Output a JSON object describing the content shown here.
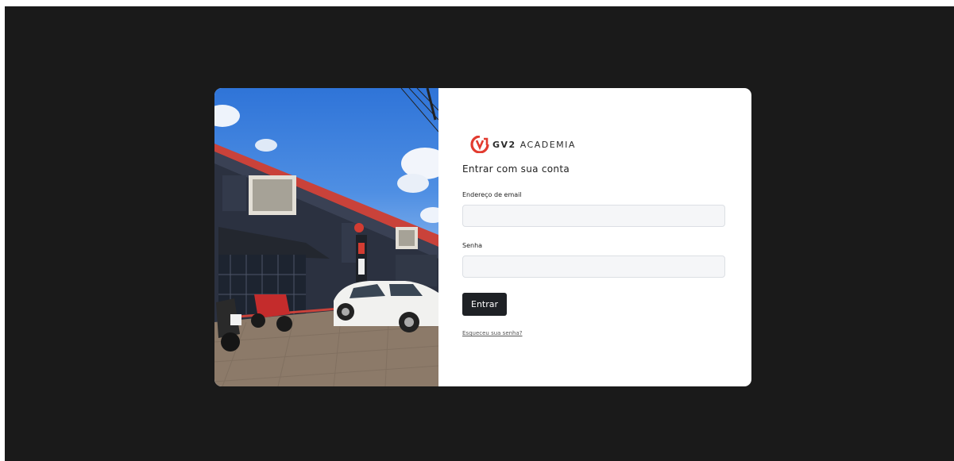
{
  "brand": {
    "name_bold": "GV2",
    "name_light": "ACADEMIA",
    "accent_color": "#e23b30",
    "logo_icon": "gv2-logo-icon"
  },
  "login": {
    "heading": "Entrar com sua conta",
    "email_label": "Endereço de email",
    "email_value": "",
    "password_label": "Senha",
    "password_value": "",
    "submit_label": "Entrar",
    "forgot_link": "Esqueceu sua senha?"
  },
  "photo": {
    "description_icon": "gym-building-photo"
  }
}
